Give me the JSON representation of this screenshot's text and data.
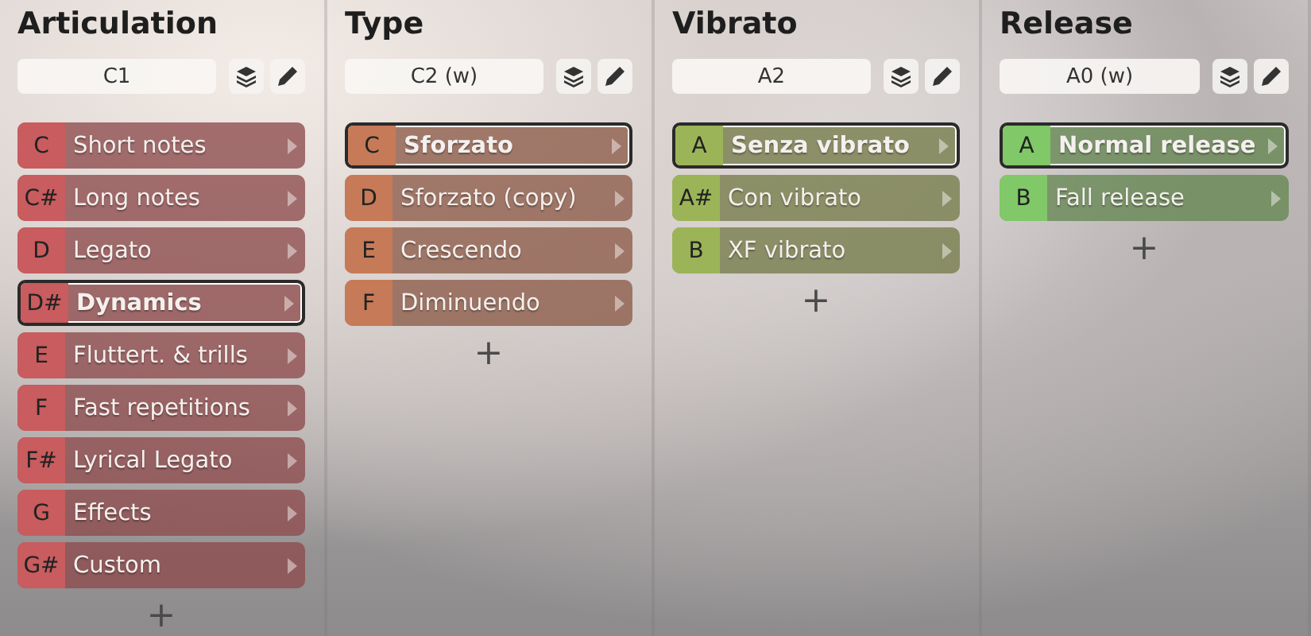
{
  "columns": [
    {
      "title": "Articulation",
      "key_field": "C1",
      "color": "#c85c5e",
      "add": "+",
      "items": [
        {
          "key": "C",
          "label": "Short notes",
          "selected": false
        },
        {
          "key": "C#",
          "label": "Long notes",
          "selected": false
        },
        {
          "key": "D",
          "label": "Legato",
          "selected": false
        },
        {
          "key": "D#",
          "label": "Dynamics",
          "selected": true
        },
        {
          "key": "E",
          "label": "Fluttert. & trills",
          "selected": false
        },
        {
          "key": "F",
          "label": "Fast repetitions",
          "selected": false
        },
        {
          "key": "F#",
          "label": "Lyrical Legato",
          "selected": false
        },
        {
          "key": "G",
          "label": "Effects",
          "selected": false
        },
        {
          "key": "G#",
          "label": "Custom",
          "selected": false
        }
      ]
    },
    {
      "title": "Type",
      "key_field": "C2 (w)",
      "color": "#c67a58",
      "add": "+",
      "items": [
        {
          "key": "C",
          "label": "Sforzato",
          "selected": true
        },
        {
          "key": "D",
          "label": "Sforzato (copy)",
          "selected": false
        },
        {
          "key": "E",
          "label": "Crescendo",
          "selected": false
        },
        {
          "key": "F",
          "label": "Diminuendo",
          "selected": false
        }
      ]
    },
    {
      "title": "Vibrato",
      "key_field": "A2",
      "color": "#9cb458",
      "add": "+",
      "items": [
        {
          "key": "A",
          "label": "Senza vibrato",
          "selected": true
        },
        {
          "key": "A#",
          "label": "Con vibrato",
          "selected": false
        },
        {
          "key": "B",
          "label": "XF vibrato",
          "selected": false
        }
      ]
    },
    {
      "title": "Release",
      "key_field": "A0 (w)",
      "color": "#80c868",
      "add": "+",
      "items": [
        {
          "key": "A",
          "label": "Normal release",
          "selected": true
        },
        {
          "key": "B",
          "label": "Fall release",
          "selected": false
        }
      ]
    }
  ]
}
